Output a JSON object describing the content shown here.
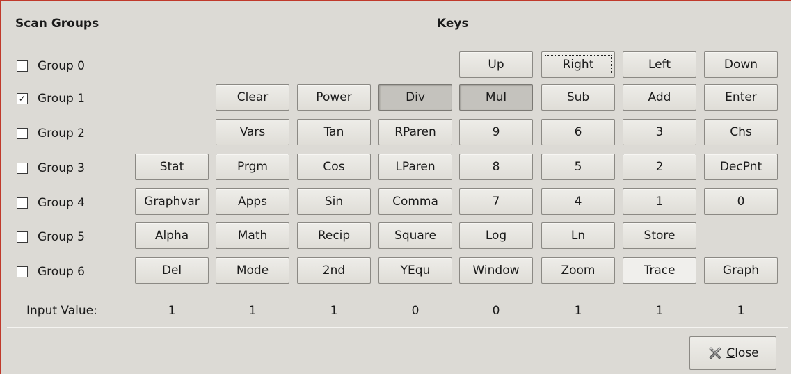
{
  "headers": {
    "scan_groups": "Scan Groups",
    "keys": "Keys"
  },
  "groups": [
    {
      "label": "Group 0",
      "checked": false
    },
    {
      "label": "Group 1",
      "checked": true
    },
    {
      "label": "Group 2",
      "checked": false
    },
    {
      "label": "Group 3",
      "checked": false
    },
    {
      "label": "Group 4",
      "checked": false
    },
    {
      "label": "Group 5",
      "checked": false
    },
    {
      "label": "Group 6",
      "checked": false
    }
  ],
  "key_rows": [
    [
      "",
      "",
      "",
      "",
      "Up",
      "Right",
      "Left",
      "Down"
    ],
    [
      "",
      "Clear",
      "Power",
      "Div",
      "Mul",
      "Sub",
      "Add",
      "Enter"
    ],
    [
      "",
      "Vars",
      "Tan",
      "RParen",
      "9",
      "6",
      "3",
      "Chs"
    ],
    [
      "Stat",
      "Prgm",
      "Cos",
      "LParen",
      "8",
      "5",
      "2",
      "DecPnt"
    ],
    [
      "Graphvar",
      "Apps",
      "Sin",
      "Comma",
      "7",
      "4",
      "1",
      "0"
    ],
    [
      "Alpha",
      "Math",
      "Recip",
      "Square",
      "Log",
      "Ln",
      "Store",
      ""
    ],
    [
      "Del",
      "Mode",
      "2nd",
      "YEqu",
      "Window",
      "Zoom",
      "Trace",
      "Graph"
    ]
  ],
  "pressed_keys": [
    "Div",
    "Mul"
  ],
  "focused_key": "Right",
  "hover_key": "Trace",
  "input_value_label": "Input Value:",
  "input_values": [
    "1",
    "1",
    "1",
    "0",
    "0",
    "1",
    "1",
    "1"
  ],
  "close_button": {
    "mnemonic": "C",
    "rest": "lose"
  },
  "icons": {
    "close": "close-x-icon"
  }
}
